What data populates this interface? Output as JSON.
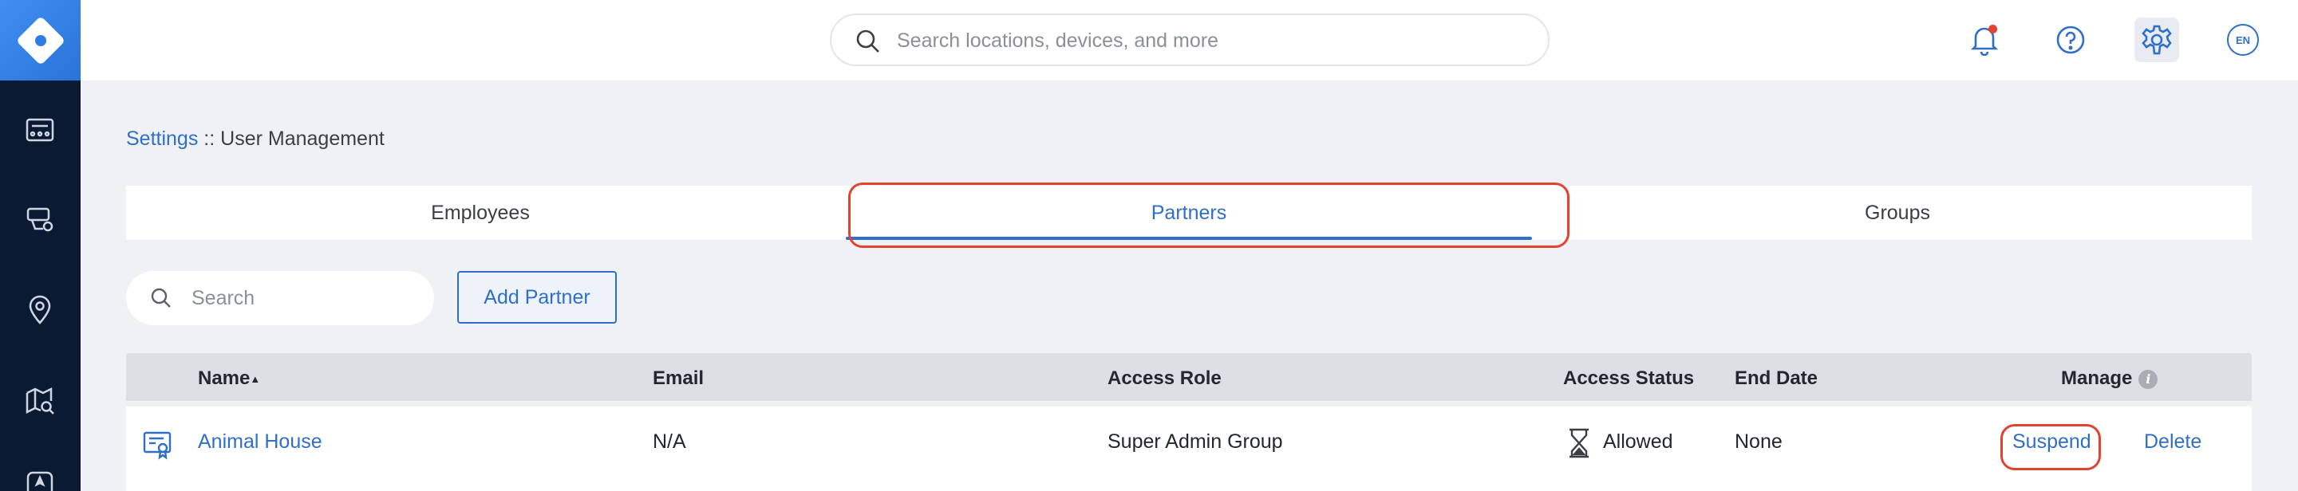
{
  "search": {
    "placeholder": "Search locations, devices, and more"
  },
  "header": {
    "language": "EN"
  },
  "breadcrumb": {
    "parent": "Settings",
    "separator": "::",
    "current": "User Management"
  },
  "tabs": [
    {
      "label": "Employees",
      "active": false
    },
    {
      "label": "Partners",
      "active": true
    },
    {
      "label": "Groups",
      "active": false
    }
  ],
  "toolbar": {
    "search_placeholder": "Search",
    "add_label": "Add Partner"
  },
  "table": {
    "columns": [
      "Name",
      "Email",
      "Access Role",
      "Access Status",
      "End Date",
      "Manage"
    ],
    "sort_indicator": "▲",
    "rows": [
      {
        "name": "Animal House",
        "email": "N/A",
        "access_role": "Super Admin Group",
        "access_status": "Allowed",
        "end_date": "None",
        "actions": [
          "Suspend",
          "Delete"
        ]
      }
    ]
  },
  "colors": {
    "accent": "#2f6fc9",
    "sidebar": "#0b1a33",
    "highlight": "#e0432f",
    "notification": "#e0432f"
  }
}
